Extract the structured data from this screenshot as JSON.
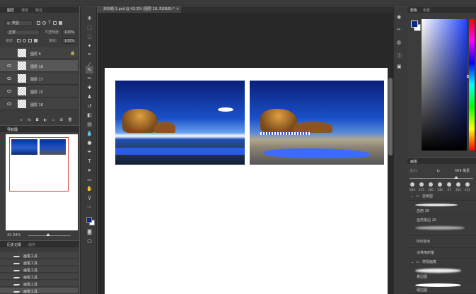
{
  "layers_panel": {
    "tabs": [
      "图层",
      "通道",
      "路径"
    ],
    "filter_kind": "类型",
    "blend_mode": "正常",
    "opacity_label": "不透明度:",
    "opacity_value": "100%",
    "lock_label": "锁定:",
    "fill_label": "填充:",
    "fill_value": "100%",
    "layers": [
      {
        "name": "图层 6",
        "locked": true,
        "visible": false,
        "selected": false
      },
      {
        "name": "图层 18",
        "locked": false,
        "visible": true,
        "selected": true
      },
      {
        "name": "图层 17",
        "locked": false,
        "visible": true,
        "selected": false
      },
      {
        "name": "图层 15",
        "locked": false,
        "visible": true,
        "selected": false
      },
      {
        "name": "图层 16",
        "locked": false,
        "visible": true,
        "selected": false
      }
    ]
  },
  "navigator": {
    "tab": "导航器",
    "zoom": "42.34%"
  },
  "history": {
    "tabs": [
      "历史记录",
      "动作"
    ],
    "items": [
      "画笔工具",
      "画笔工具",
      "画笔工具",
      "画笔工具",
      "画笔工具",
      "画笔工具"
    ]
  },
  "document": {
    "tab_title": "未标题-1.psd @ 42.3% (图层 18, RGB/8) *"
  },
  "color_panel": {
    "tabs": [
      "颜色",
      "色板"
    ],
    "foreground": "#0a2a8a",
    "background": "#ffffff"
  },
  "brushes_panel": {
    "tab": "画笔",
    "size_label": "大小:",
    "size_value": "569 像素",
    "sizes": [
      "569",
      "175",
      "200",
      "136",
      "57",
      "265",
      "231"
    ],
    "folder_general": "常规画笔",
    "folder_custom": "自用型",
    "items": [
      "自用 20",
      "自然柔边 20",
      "600加水",
      "冰林用的笔",
      "柔边圆",
      "硬边圆"
    ]
  },
  "colors": {
    "ui_dark": "#2b2b2b",
    "panel": "#3c3c3c",
    "accent_nav": "#d43c3c"
  }
}
